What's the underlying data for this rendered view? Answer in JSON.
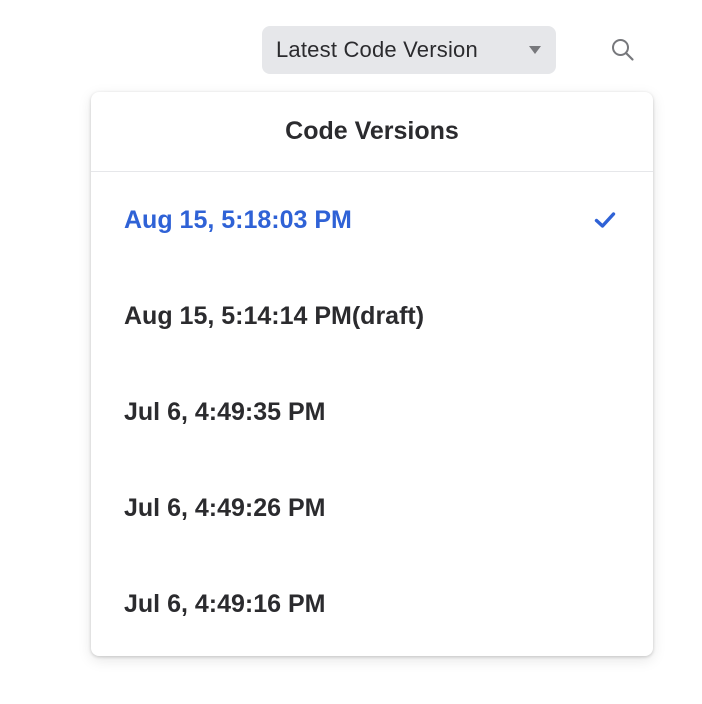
{
  "toolbar": {
    "version_select_label": "Latest Code Version",
    "caret_icon": "caret-down-icon",
    "search_icon": "search-icon"
  },
  "menu": {
    "title": "Code Versions",
    "items": [
      {
        "label": "Aug 15, 5:18:03 PM",
        "selected": true
      },
      {
        "label": "Aug 15, 5:14:14 PM(draft)",
        "selected": false
      },
      {
        "label": "Jul 6, 4:49:35 PM",
        "selected": false
      },
      {
        "label": "Jul 6, 4:49:26 PM",
        "selected": false
      },
      {
        "label": "Jul 6, 4:49:16 PM",
        "selected": false
      }
    ],
    "check_icon": "checkmark-icon"
  },
  "colors": {
    "accent": "#2f62d6",
    "text": "#2b2b2e",
    "select_background": "#e6e7ea"
  }
}
